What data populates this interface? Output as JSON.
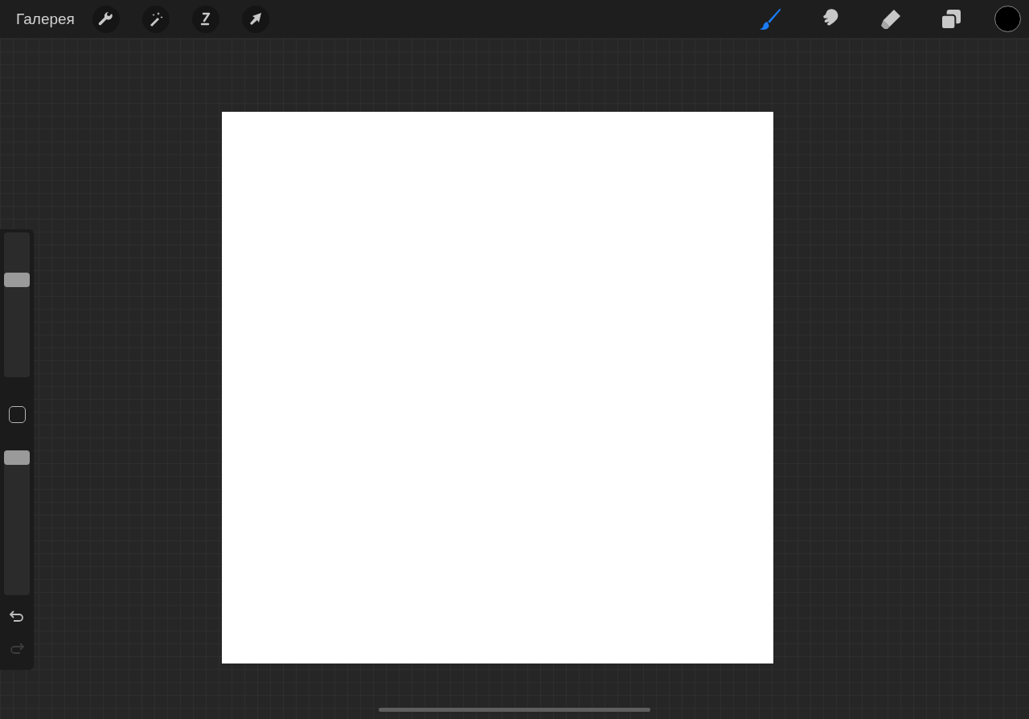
{
  "top_bar": {
    "gallery_label": "Галерея",
    "actions": [
      {
        "kind": "wrench"
      },
      {
        "kind": "wand"
      },
      {
        "kind": "selection"
      },
      {
        "kind": "transform"
      }
    ],
    "tools": [
      {
        "kind": "brush",
        "selected": true
      },
      {
        "kind": "smudge",
        "selected": false
      },
      {
        "kind": "eraser",
        "selected": false
      },
      {
        "kind": "layers",
        "selected": false
      }
    ]
  },
  "sidebar": {
    "size_slider": {
      "level": 0.69
    },
    "opacity_slider": {
      "level": 1.0
    },
    "history": [
      {
        "kind": "undo",
        "disabled": false
      },
      {
        "kind": "redo",
        "disabled": true
      }
    ]
  }
}
